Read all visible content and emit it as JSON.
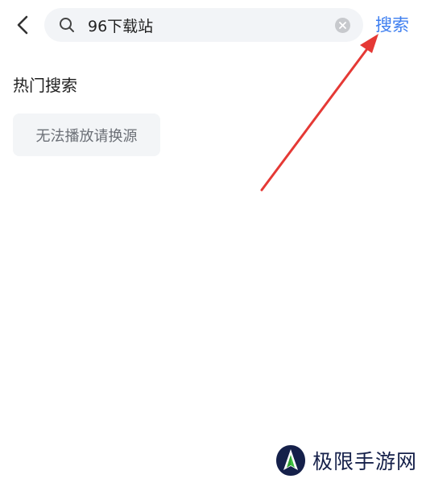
{
  "header": {
    "back_icon": "chevron-left-icon",
    "search": {
      "value": "96下载站",
      "placeholder": "",
      "search_icon": "search-icon",
      "clear_icon": "clear-circle-icon"
    },
    "search_button_label": "搜索"
  },
  "hot_search": {
    "title": "热门搜索",
    "tags": [
      "无法播放请换源"
    ]
  },
  "annotation": {
    "arrow_color": "#e53935"
  },
  "watermark": {
    "text": "极限手游网"
  },
  "colors": {
    "accent": "#3d7ef0",
    "search_bg": "#f2f4f7",
    "tag_bg": "#f3f5f7"
  }
}
